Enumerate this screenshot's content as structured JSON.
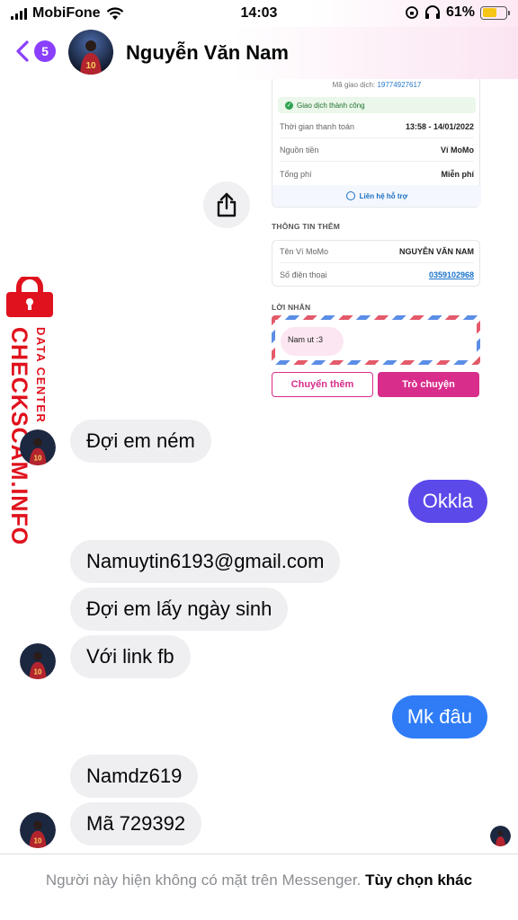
{
  "status_bar": {
    "carrier": "MobiFone",
    "time": "14:03",
    "battery_percent": "61%",
    "battery_level": 0.61,
    "battery_color": "#f5c518"
  },
  "header": {
    "unread_count": "5",
    "contact_name": "Nguyễn Văn Nam",
    "accent_color": "#8a3ffc"
  },
  "receipt": {
    "transaction_label": "Mã giao dịch:",
    "transaction_id": "19774927617",
    "status": "Giao dịch thành công",
    "rows": [
      {
        "label": "Thời gian thanh toán",
        "value": "13:58 - 14/01/2022"
      },
      {
        "label": "Nguồn tiền",
        "value": "Ví MoMo"
      },
      {
        "label": "Tổng phí",
        "value": "Miễn phí"
      }
    ],
    "support_link": "Liên hệ hỗ trợ",
    "extra_title": "THÔNG TIN THÊM",
    "extra_rows": [
      {
        "label": "Tên Ví MoMo",
        "value": "NGUYỄN VĂN NAM"
      },
      {
        "label": "Số điện thoại",
        "value": "0359102968"
      }
    ],
    "note_title": "LỜI NHẮN",
    "note_text": "Nam ut :3",
    "button_transfer": "Chuyển thêm",
    "button_chat": "Trò chuyện",
    "brand_color": "#d82d8b"
  },
  "watermark": {
    "main": "CHECKSCAM.INFO",
    "sub": "DATA CENTER",
    "color": "#e0121d"
  },
  "messages": [
    {
      "from": "them",
      "text": "Đợi em ném"
    },
    {
      "from": "me",
      "text": "Okkla"
    },
    {
      "from": "them",
      "text": "Namuytin6193@gmail.com"
    },
    {
      "from": "them",
      "text": "Đợi em lấy ngày sinh"
    },
    {
      "from": "them",
      "text": "Với link fb"
    },
    {
      "from": "me",
      "text": "Mk đâu"
    },
    {
      "from": "them",
      "text": "Namdz619"
    },
    {
      "from": "them",
      "text": "Mã 729392"
    }
  ],
  "footer": {
    "notice": "Người này hiện không có mặt trên Messenger.",
    "action": "Tùy chọn khác"
  }
}
